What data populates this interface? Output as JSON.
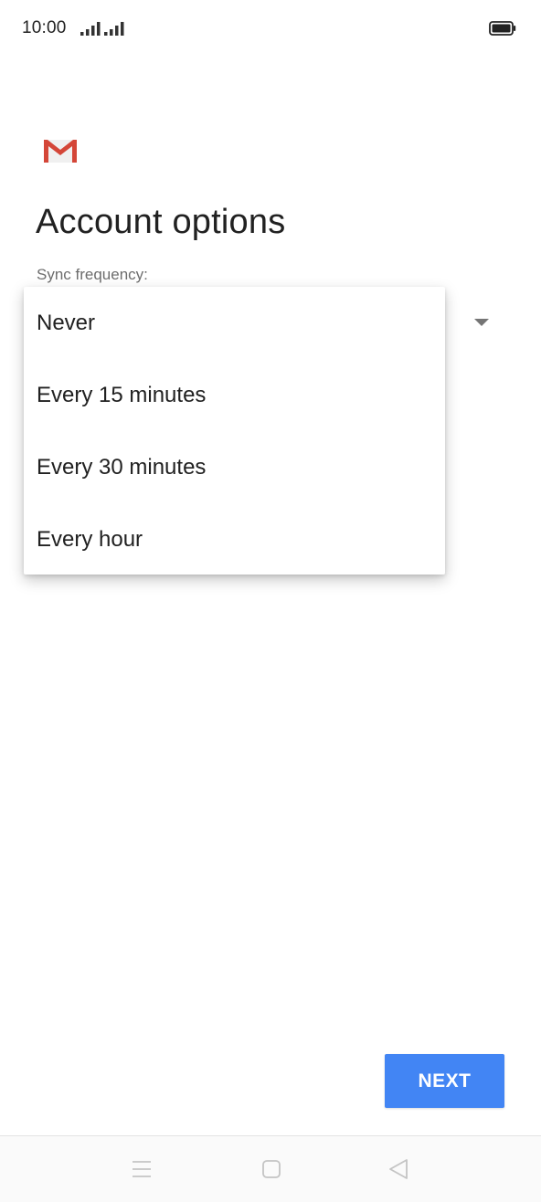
{
  "status_bar": {
    "time": "10:00",
    "icons": [
      "signal-icon",
      "signal-icon",
      "battery-icon"
    ]
  },
  "app": {
    "logo": "gmail-logo",
    "colors": {
      "gmail_red": "#d44638",
      "accent": "#4285f4"
    }
  },
  "page": {
    "title": "Account options"
  },
  "sync_frequency": {
    "label": "Sync frequency:",
    "options": [
      "Never",
      "Every 15 minutes",
      "Every 30 minutes",
      "Every hour"
    ]
  },
  "footer": {
    "next_label": "NEXT"
  },
  "nav_bar": {
    "icons": [
      "menu-icon",
      "home-icon",
      "back-icon"
    ]
  }
}
